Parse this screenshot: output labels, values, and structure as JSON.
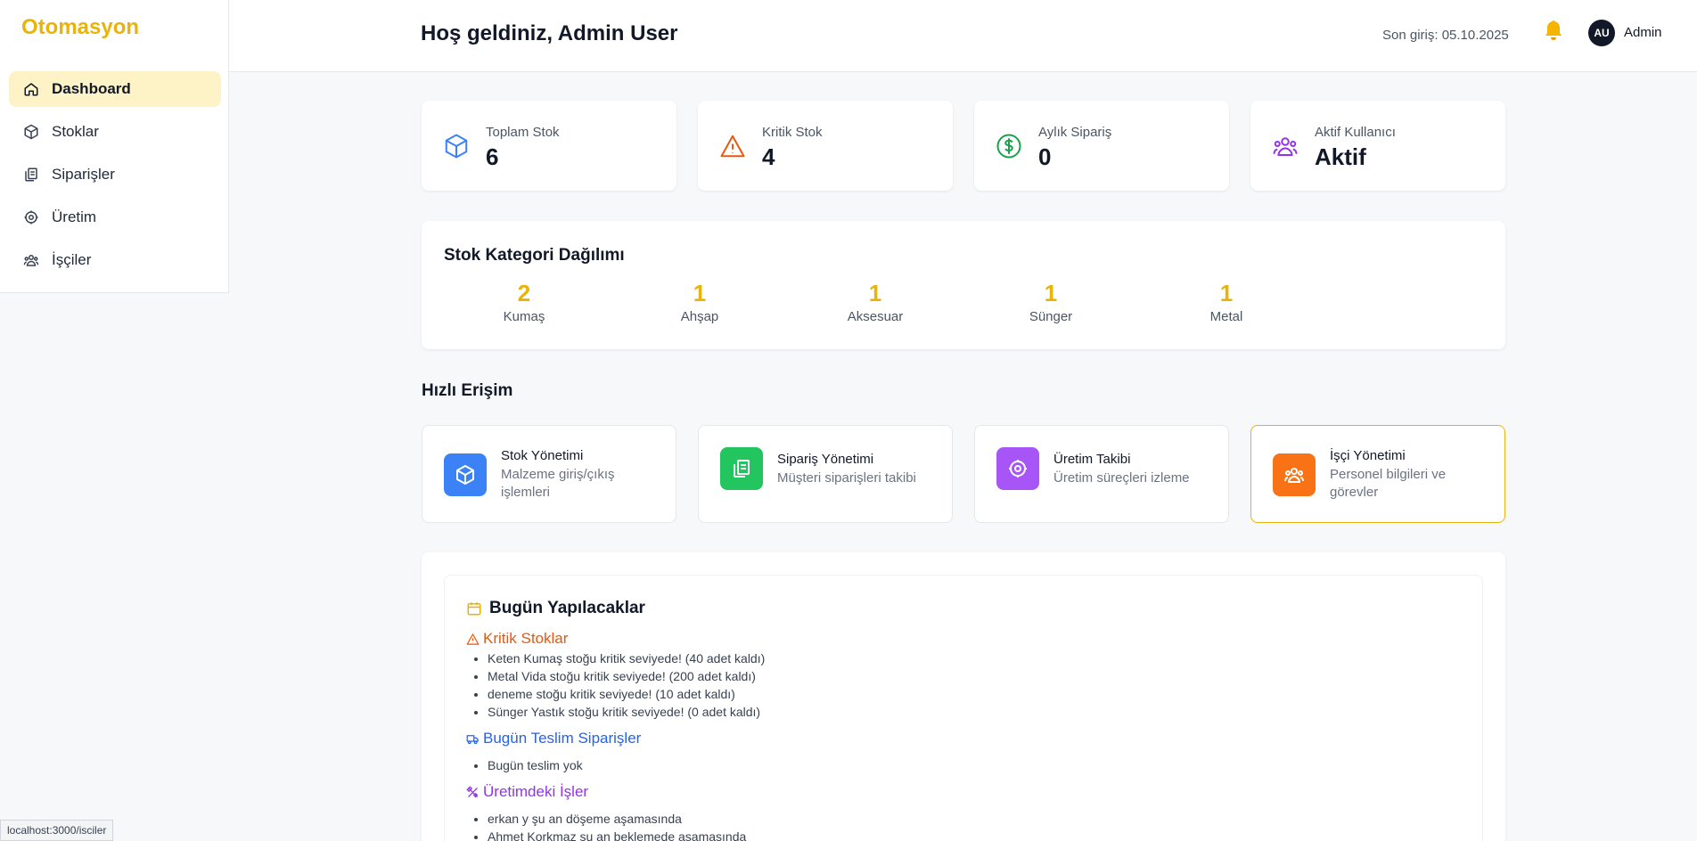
{
  "brand": "Otomasyon",
  "nav": [
    {
      "label": "Dashboard",
      "icon": "home-icon"
    },
    {
      "label": "Stoklar",
      "icon": "box-icon"
    },
    {
      "label": "Siparişler",
      "icon": "clipboard-icon"
    },
    {
      "label": "Üretim",
      "icon": "gear-icon"
    },
    {
      "label": "İşçiler",
      "icon": "users-icon"
    }
  ],
  "header": {
    "welcome": "Hoş geldiniz, Admin User",
    "last_login": "Son giriş: 05.10.2025",
    "avatar_initials": "AU",
    "user_name": "Admin"
  },
  "stats": [
    {
      "label": "Toplam Stok",
      "value": "6",
      "color": "#3b82f6"
    },
    {
      "label": "Kritik Stok",
      "value": "4",
      "color": "#ea580c"
    },
    {
      "label": "Aylık Sipariş",
      "value": "0",
      "color": "#16a34a"
    },
    {
      "label": "Aktif Kullanıcı",
      "value": "Aktif",
      "color": "#9333ea"
    }
  ],
  "categories": {
    "title": "Stok Kategori Dağılımı",
    "items": [
      {
        "count": "2",
        "name": "Kumaş"
      },
      {
        "count": "1",
        "name": "Ahşap"
      },
      {
        "count": "1",
        "name": "Aksesuar"
      },
      {
        "count": "1",
        "name": "Sünger"
      },
      {
        "count": "1",
        "name": "Metal"
      }
    ]
  },
  "quick_access": {
    "title": "Hızlı Erişim",
    "items": [
      {
        "title": "Stok Yönetimi",
        "desc": "Malzeme giriş/çıkış işlemleri",
        "color": "#3b82f6"
      },
      {
        "title": "Sipariş Yönetimi",
        "desc": "Müşteri siparişleri takibi",
        "color": "#22c55e"
      },
      {
        "title": "Üretim Takibi",
        "desc": "Üretim süreçleri izleme",
        "color": "#a855f7"
      },
      {
        "title": "İşçi Yönetimi",
        "desc": "Personel bilgileri ve görevler",
        "color": "#f97316"
      }
    ]
  },
  "todo": {
    "title": "Bugün Yapılacaklar",
    "critical": {
      "title": "Kritik Stoklar",
      "items": [
        "Keten Kumaş stoğu kritik seviyede! (40 adet kaldı)",
        "Metal Vida stoğu kritik seviyede! (200 adet kaldı)",
        "deneme stoğu kritik seviyede! (10 adet kaldı)",
        "Sünger Yastık stoğu kritik seviyede! (0 adet kaldı)"
      ]
    },
    "deliveries": {
      "title": "Bugün Teslim Siparişler",
      "items": [
        "Bugün teslim yok"
      ]
    },
    "production": {
      "title": "Üretimdeki İşler",
      "items": [
        "erkan y şu an döşeme aşamasında",
        "Ahmet Korkmaz şu an beklemede aşamasında"
      ]
    }
  },
  "status_url": "localhost:3000/isciler"
}
